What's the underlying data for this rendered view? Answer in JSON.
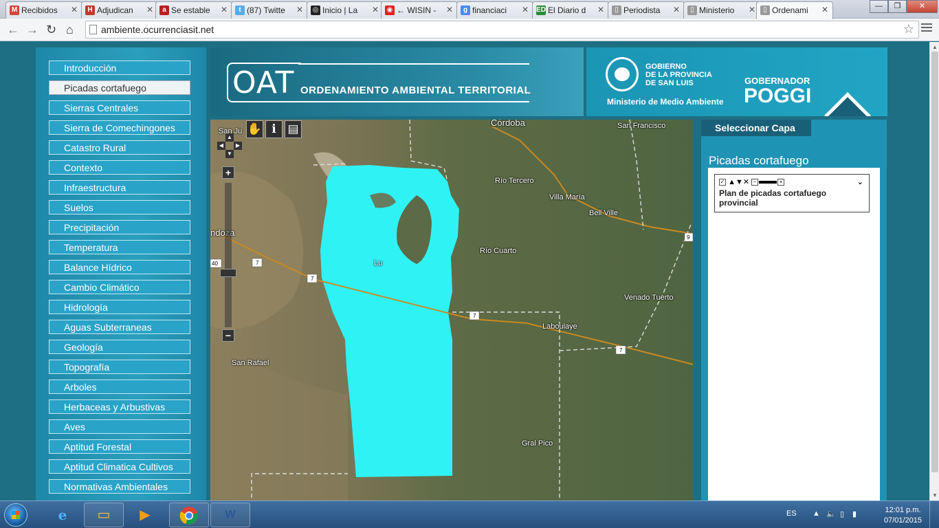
{
  "browser": {
    "tabs": [
      {
        "label": "Recibidos",
        "fav": "M",
        "color": "#d44638"
      },
      {
        "label": "Adjudican",
        "fav": "H",
        "color": "#c0392b"
      },
      {
        "label": "Se estable",
        "fav": "a",
        "color": "#b22222"
      },
      {
        "label": "(87) Twitte",
        "fav": "t",
        "color": "#55acee"
      },
      {
        "label": "Inicio | La",
        "fav": "◎",
        "color": "#222222"
      },
      {
        "label": "← WISIN -",
        "fav": "◉",
        "color": "#d22"
      },
      {
        "label": "financiaci",
        "fav": "g",
        "color": "#4a8af4"
      },
      {
        "label": "El Diario d",
        "fav": "ED",
        "color": "#2a8a3a"
      },
      {
        "label": "Periodista",
        "fav": "▯",
        "color": "#999999"
      },
      {
        "label": "Ministerio",
        "fav": "▯",
        "color": "#999999"
      },
      {
        "label": "Ordenami",
        "fav": "▯",
        "color": "#999999"
      }
    ],
    "url": "ambiente.ocurrenciasit.net"
  },
  "sidebar": {
    "items": [
      "Introducción",
      "Picadas cortafuego",
      "Sierras Centrales",
      "Sierra de Comechingones",
      "Catastro Rural",
      "Contexto",
      "Infraestructura",
      "Suelos",
      "Precipitación",
      "Temperatura",
      "Balance Hídrico",
      "Cambio Climático",
      "Hidrología",
      "Aguas Subterraneas",
      "Geología",
      "Topografía",
      "Arboles",
      "Herbaceas y Arbustivas",
      "Aves",
      "Aptitud Forestal",
      "Aptitud Climatica Cultivos",
      "Normativas Ambientales"
    ],
    "active_index": 1
  },
  "banner": {
    "logo": "OAT",
    "subtitle": "ORDENAMIENTO AMBIENTAL TERRITORIAL"
  },
  "gov": {
    "line1": "GOBIERNO",
    "line2": "DE LA PROVINCIA",
    "line3": "DE SAN LUIS",
    "ministry": "Ministerio de Medio Ambiente",
    "gobernador": "GOBERNADOR",
    "name": "POGGI"
  },
  "map": {
    "tools": [
      "hand-icon",
      "info-icon",
      "print-icon"
    ],
    "zoom_in": "+",
    "zoom_out": "−",
    "labels": [
      {
        "text": "Córdoba",
        "big": true
      },
      {
        "text": "San Francisco"
      },
      {
        "text": "San Ju"
      },
      {
        "text": "Río Tercero"
      },
      {
        "text": "Villa María"
      },
      {
        "text": "Bell Ville"
      },
      {
        "text": "Río Cuarto"
      },
      {
        "text": "ndoza",
        "big": true
      },
      {
        "text": "Lu"
      },
      {
        "text": "Venado Tuerto"
      },
      {
        "text": "Laboulaye"
      },
      {
        "text": "San Rafael"
      },
      {
        "text": "Gral Pico"
      }
    ]
  },
  "layers": {
    "tab": "Seleccionar Capa",
    "title": "Picadas cortafuego",
    "item_name": "Plan de picadas cortafuego provincial",
    "controls": "▲▼✕"
  },
  "taskbar": {
    "lang": "ES",
    "time": "12:01 p.m.",
    "date": "07/01/2015"
  }
}
